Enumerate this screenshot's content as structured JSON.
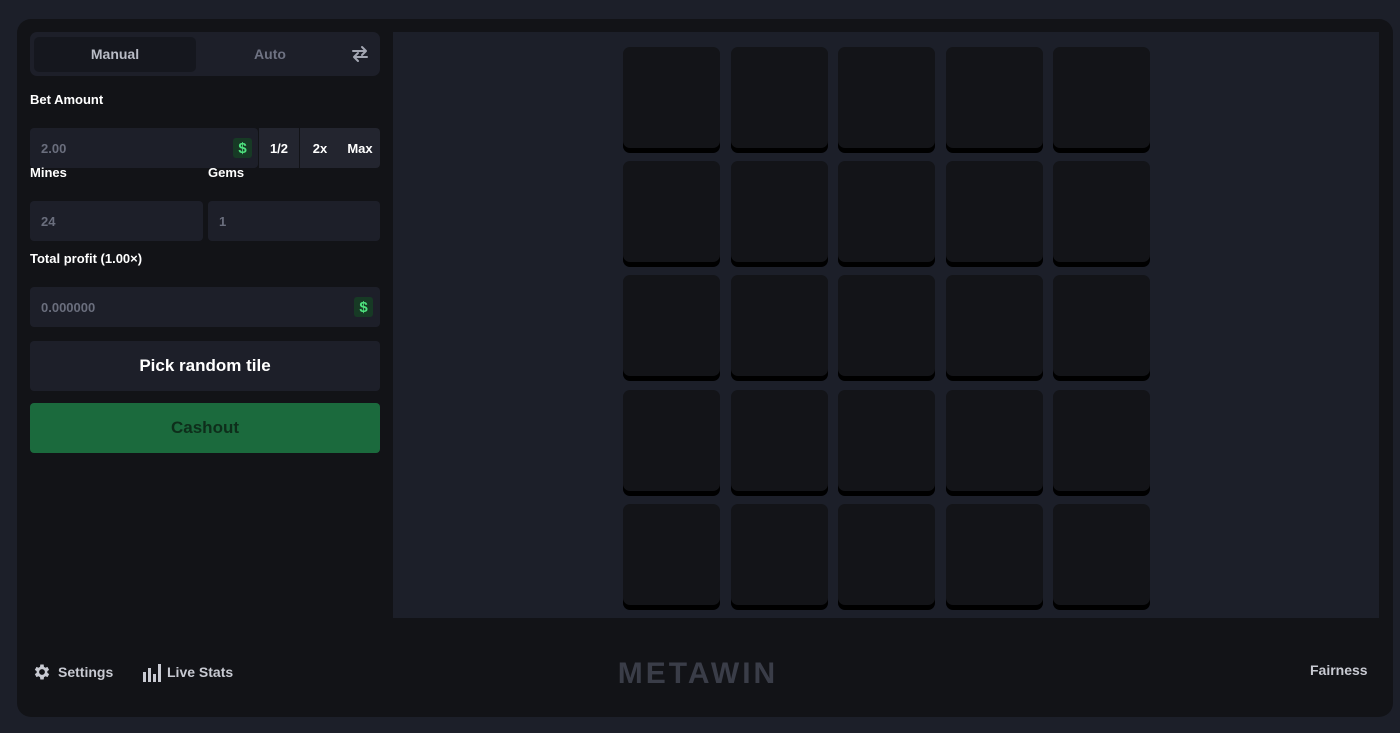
{
  "mode_tabs": {
    "manual": "Manual",
    "auto": "Auto",
    "swap_icon": "swap-arrows-icon"
  },
  "bet": {
    "label": "Bet Amount",
    "placeholder": "2.00",
    "currency_symbol": "$",
    "half_label": "1/2",
    "double_label": "2x",
    "max_label": "Max"
  },
  "mines": {
    "label": "Mines",
    "placeholder": "24"
  },
  "gems": {
    "label": "Gems",
    "placeholder": "1"
  },
  "profit": {
    "label": "Total profit (1.00×)",
    "placeholder": "0.000000",
    "currency_symbol": "$"
  },
  "actions": {
    "pick_random": "Pick random tile",
    "cashout": "Cashout"
  },
  "board": {
    "rows": 5,
    "cols": 5
  },
  "footer": {
    "settings": "Settings",
    "live_stats": "Live Stats",
    "brand": "METAWIN",
    "fairness": "Fairness"
  },
  "colors": {
    "accent_green": "#1b6a3d",
    "currency_green": "#4ee27e",
    "panel": "#1d1f29",
    "background": "#121317"
  }
}
